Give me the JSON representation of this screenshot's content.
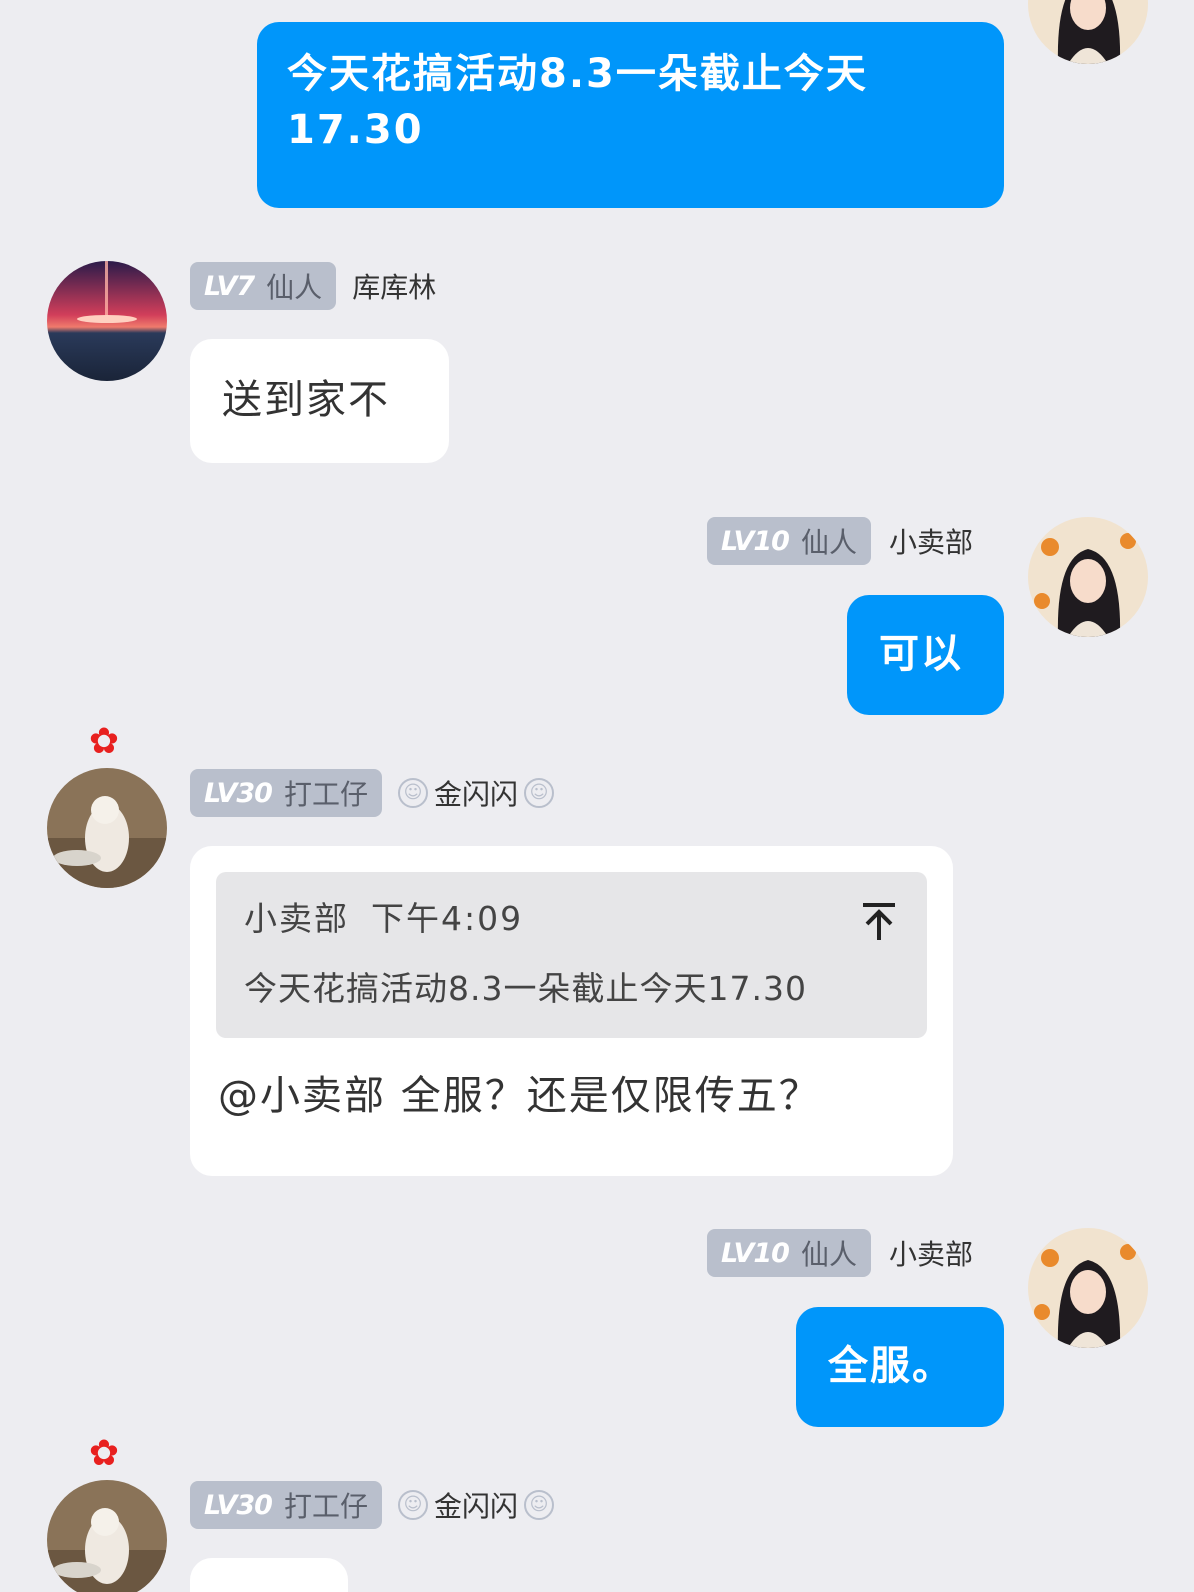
{
  "messages": [
    {
      "id": "m1",
      "direction": "out",
      "text": "今天花搞活动8.3一朵截止今天17.30"
    },
    {
      "id": "m2",
      "direction": "in",
      "badge": {
        "level": "LV7",
        "title": "仙人"
      },
      "nickname": "库库林",
      "text": "送到家不"
    },
    {
      "id": "m3",
      "direction": "out",
      "badge": {
        "level": "LV10",
        "title": "仙人"
      },
      "nickname": "小卖部",
      "text": "可以"
    },
    {
      "id": "m4",
      "direction": "in",
      "badge": {
        "level": "LV30",
        "title": "打工仔"
      },
      "nickname": "金闪闪",
      "quote": {
        "author": "小卖部",
        "time": "下午4:09",
        "text": "今天花搞活动8.3一朵截止今天17.30"
      },
      "text": "@小卖部 全服？还是仅限传五？"
    },
    {
      "id": "m5",
      "direction": "out",
      "badge": {
        "level": "LV10",
        "title": "仙人"
      },
      "nickname": "小卖部",
      "text": "全服。"
    },
    {
      "id": "m6",
      "direction": "in",
      "badge": {
        "level": "LV30",
        "title": "打工仔"
      },
      "nickname": "金闪闪",
      "text": ""
    }
  ],
  "icons": {
    "flower": "✿",
    "smile": "☺"
  },
  "colors": {
    "background": "#ededf1",
    "outgoing_bubble": "#0096fa",
    "incoming_bubble": "#ffffff",
    "badge": "#b9bfcc"
  }
}
